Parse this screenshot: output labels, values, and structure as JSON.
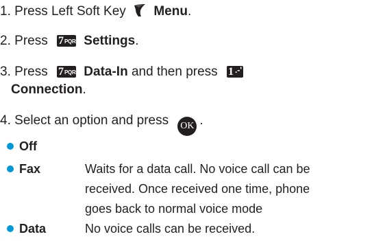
{
  "steps": [
    {
      "num": "1.",
      "pre": "Press Left Soft Key",
      "label": "Menu",
      "post": "."
    },
    {
      "num": "2.",
      "pre": "Press",
      "label": "Settings",
      "post": "."
    },
    {
      "num": "3.",
      "pre": "Press",
      "label": "Data-In",
      "mid": "and then press",
      "label2": "Connection",
      "post": "."
    },
    {
      "num": "4.",
      "pre": "Select an option and press",
      "post": "."
    }
  ],
  "keys": {
    "seven_big": "7",
    "seven_small": "PQRS",
    "one_big": "1",
    "one_small": ".-'",
    "ok": "OK"
  },
  "options": [
    {
      "name": "Off",
      "desc": []
    },
    {
      "name": "Fax",
      "desc": [
        "Waits for a data call. No voice call can be",
        "received. Once received one time, phone",
        "goes back to normal voice mode"
      ]
    },
    {
      "name": "Data",
      "desc": [
        "No voice calls can be received."
      ]
    }
  ],
  "colors": {
    "text": "#231f20",
    "bullet": "#0099d8"
  }
}
